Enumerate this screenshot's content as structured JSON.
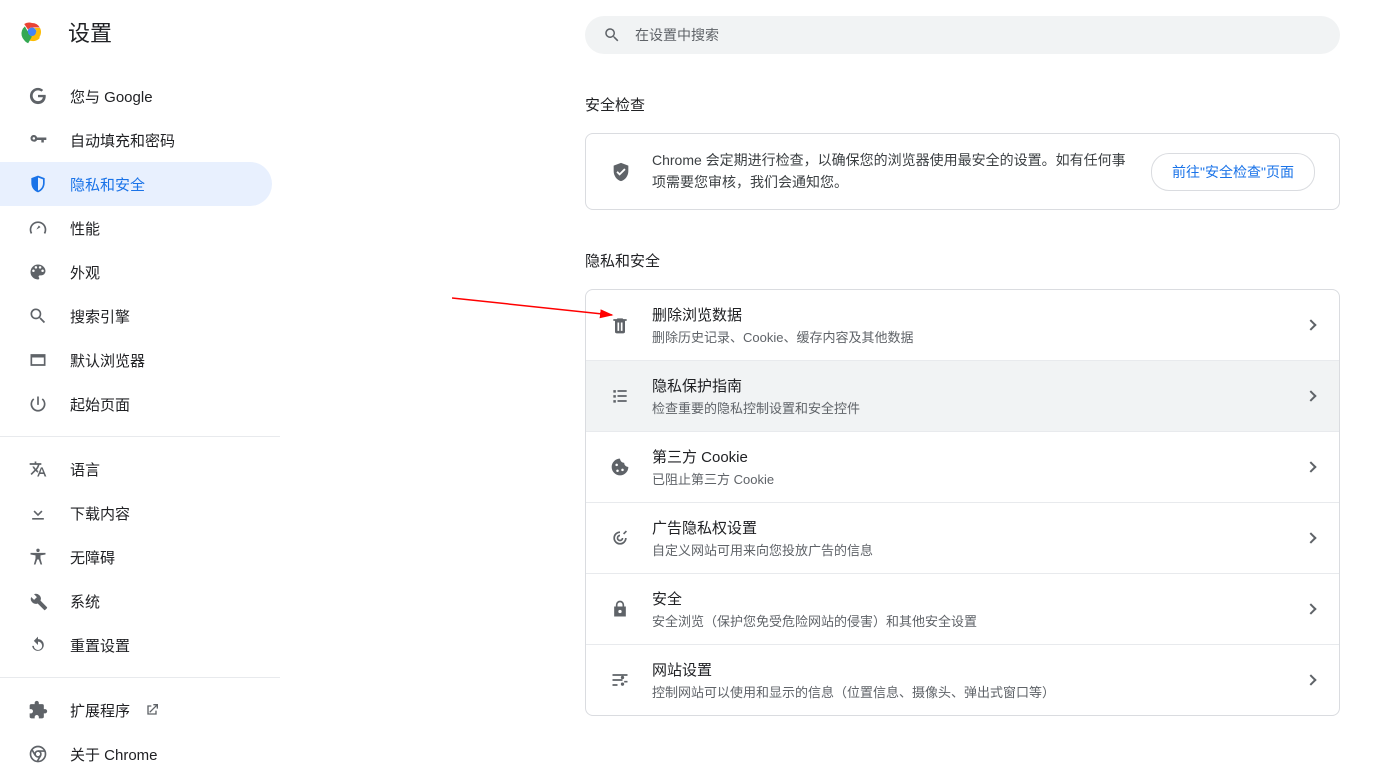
{
  "header": {
    "title": "设置"
  },
  "search": {
    "placeholder": "在设置中搜索"
  },
  "sidebar": {
    "items": [
      {
        "label": "您与 Google"
      },
      {
        "label": "自动填充和密码"
      },
      {
        "label": "隐私和安全"
      },
      {
        "label": "性能"
      },
      {
        "label": "外观"
      },
      {
        "label": "搜索引擎"
      },
      {
        "label": "默认浏览器"
      },
      {
        "label": "起始页面"
      }
    ],
    "items2": [
      {
        "label": "语言"
      },
      {
        "label": "下载内容"
      },
      {
        "label": "无障碍"
      },
      {
        "label": "系统"
      },
      {
        "label": "重置设置"
      }
    ],
    "items3": [
      {
        "label": "扩展程序"
      },
      {
        "label": "关于 Chrome"
      }
    ]
  },
  "sections": {
    "safety_title": "安全检查",
    "safety_desc": "Chrome 会定期进行检查，以确保您的浏览器使用最安全的设置。如有任何事项需要您审核，我们会通知您。",
    "safety_btn": "前往\"安全检查\"页面",
    "privacy_title": "隐私和安全",
    "rows": [
      {
        "title": "删除浏览数据",
        "sub": "删除历史记录、Cookie、缓存内容及其他数据"
      },
      {
        "title": "隐私保护指南",
        "sub": "检查重要的隐私控制设置和安全控件"
      },
      {
        "title": "第三方 Cookie",
        "sub": "已阻止第三方 Cookie"
      },
      {
        "title": "广告隐私权设置",
        "sub": "自定义网站可用来向您投放广告的信息"
      },
      {
        "title": "安全",
        "sub": "安全浏览（保护您免受危险网站的侵害）和其他安全设置"
      },
      {
        "title": "网站设置",
        "sub": "控制网站可以使用和显示的信息（位置信息、摄像头、弹出式窗口等）"
      }
    ]
  }
}
